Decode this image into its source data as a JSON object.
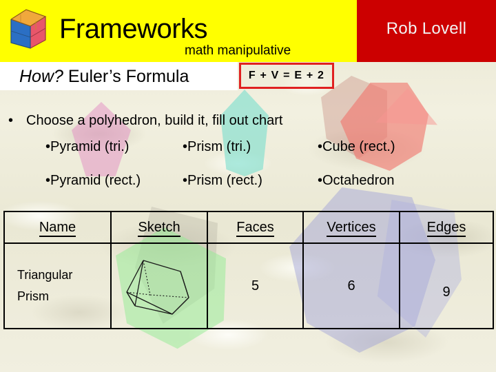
{
  "header": {
    "logo_icon": "colored-cube-icon",
    "brand_title": "Frameworks",
    "brand_subtitle": "math manipulative",
    "author": "Rob Lovell",
    "yellow_color": "#ffff00",
    "red_color": "#cc0000"
  },
  "subtitle": {
    "how_label": "How?",
    "topic_label": " Euler’s Formula",
    "formula": "F + V = E + 2",
    "formula_border_color": "#e02020"
  },
  "body": {
    "main_bullet_marker": "•",
    "main_bullet": "Choose a polyhedron, build it, fill out chart",
    "options_row_1": [
      "•Pyramid (tri.)",
      "•Prism (tri.)",
      "•Cube (rect.)"
    ],
    "options_row_2": [
      "•Pyramid (rect.)",
      "•Prism (rect.)",
      "•Octahedron"
    ]
  },
  "table": {
    "columns": [
      "Name",
      "Sketch",
      "Faces",
      "Vertices",
      "Edges"
    ],
    "rows": [
      {
        "name_line_1": "Triangular",
        "name_line_2": "Prism",
        "sketch_icon": "triangular-prism-wireframe-icon",
        "faces": "5",
        "vertices": "6",
        "edges": "9"
      }
    ]
  },
  "decor": {
    "pink_diamond": "#e496c4",
    "teal_polyhedron": "#78decd",
    "red_polyhedron": "#f0766e",
    "green_polyhedron": "#96ec96",
    "blue_polyhedron": "#a0a4d8",
    "background": "#eeecd8"
  }
}
